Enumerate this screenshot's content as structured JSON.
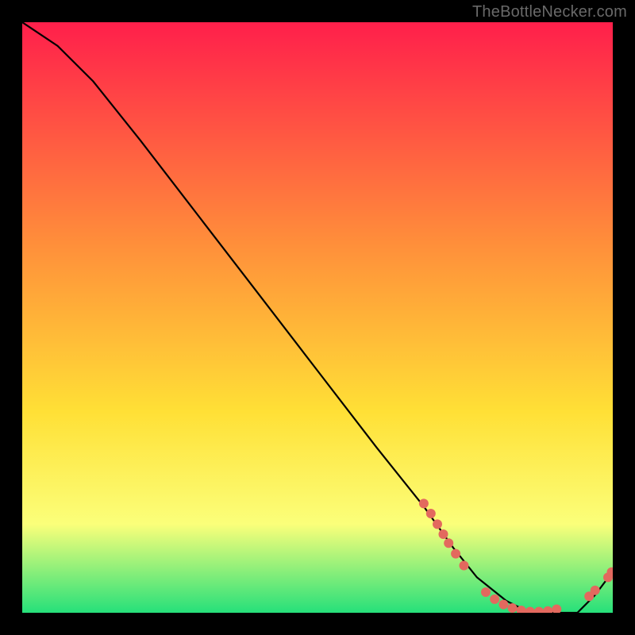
{
  "attribution": "TheBottleNecker.com",
  "colors": {
    "gradient_top": "#ff1f4b",
    "gradient_mid1": "#ff903a",
    "gradient_mid2": "#ffe036",
    "gradient_mid3": "#fbff7a",
    "gradient_bottom": "#26e07a",
    "curve": "#000000",
    "markers": "#e3695e",
    "background": "#000000"
  },
  "chart_data": {
    "type": "line",
    "title": "",
    "xlabel": "",
    "ylabel": "",
    "xlim": [
      0,
      100
    ],
    "ylim": [
      0,
      100
    ],
    "curve": {
      "x": [
        0,
        6,
        12,
        20,
        30,
        40,
        50,
        60,
        68,
        73,
        77,
        82,
        86,
        90,
        94,
        97,
        100
      ],
      "y": [
        100,
        96,
        90,
        80,
        67,
        54,
        41,
        28,
        18,
        11,
        6,
        2,
        0,
        0,
        0,
        3,
        7
      ]
    },
    "marker_clusters": [
      {
        "name": "descent-cluster",
        "points": [
          {
            "x": 68.0,
            "y": 18.5
          },
          {
            "x": 69.2,
            "y": 16.8
          },
          {
            "x": 70.3,
            "y": 15.0
          },
          {
            "x": 71.3,
            "y": 13.3
          },
          {
            "x": 72.2,
            "y": 11.8
          },
          {
            "x": 73.4,
            "y": 10.0
          },
          {
            "x": 74.8,
            "y": 8.0
          }
        ]
      },
      {
        "name": "trough-cluster",
        "points": [
          {
            "x": 78.5,
            "y": 3.5
          },
          {
            "x": 80.0,
            "y": 2.3
          },
          {
            "x": 81.5,
            "y": 1.4
          },
          {
            "x": 83.0,
            "y": 0.8
          },
          {
            "x": 84.5,
            "y": 0.4
          },
          {
            "x": 86.0,
            "y": 0.2
          },
          {
            "x": 87.5,
            "y": 0.2
          },
          {
            "x": 89.0,
            "y": 0.3
          },
          {
            "x": 90.5,
            "y": 0.6
          }
        ]
      },
      {
        "name": "ascent-cluster",
        "points": [
          {
            "x": 96.0,
            "y": 2.8
          },
          {
            "x": 97.0,
            "y": 3.8
          },
          {
            "x": 99.2,
            "y": 6.0
          },
          {
            "x": 99.8,
            "y": 6.9
          }
        ]
      }
    ]
  }
}
